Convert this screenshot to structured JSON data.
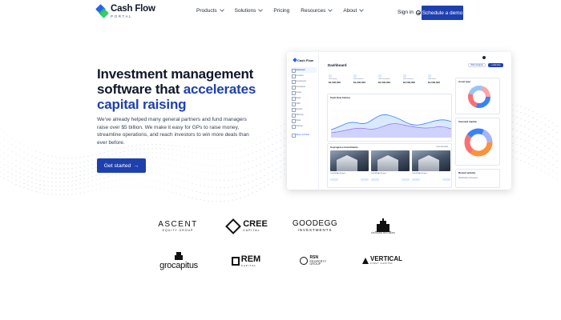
{
  "header": {
    "logo_name": "Cash Flow",
    "logo_sub": "PORTAL",
    "nav": [
      {
        "label": "Products",
        "has_menu": true
      },
      {
        "label": "Solutions",
        "has_menu": true
      },
      {
        "label": "Pricing",
        "has_menu": false
      },
      {
        "label": "Resources",
        "has_menu": true
      },
      {
        "label": "About",
        "has_menu": true
      }
    ],
    "signin_label": "Sign in",
    "demo_label": "Schedule a demo"
  },
  "hero": {
    "title_plain": "Investment management software that ",
    "title_accent": "accelerates capital raising",
    "description": "We've already helped many general partners and fund managers raise over $5 billion. We make it easy for GPs to raise money, streamline operations, and reach investors to win more deals than ever before.",
    "cta_label": "Get started",
    "cta_icon": "arrow-right-icon"
  },
  "dashboard": {
    "logo": "Cash Flow",
    "title": "Dashboard",
    "nav_items": [
      "Dashboard",
      "Investors",
      "Investments",
      "Companies",
      "Assets",
      "Deals",
      "CRM",
      "Reports",
      "Offerings",
      "Tasks",
      "Settings"
    ],
    "nav_link": "Return to Portal",
    "pills": [
      "Offer Analysis",
      "+ Add New"
    ],
    "stats": [
      {
        "label": "Total Equity",
        "value": "$1,500,000"
      },
      {
        "label": "Total Invested",
        "value": "$1,200,000"
      },
      {
        "label": "Total Distributed",
        "value": "$1,500,000"
      },
      {
        "label": "Total Investors",
        "value": "$1,500,000"
      },
      {
        "label": "Total Deals",
        "value": "$1,500,000"
      }
    ],
    "chart_title": "Cash flow history",
    "pie1_title": "Asset type",
    "pie2_title": "Invested capital",
    "investments_title": "In-progress investments",
    "investments_link": "View all deals",
    "properties": [
      "Oak Hill Apt Project",
      "Oak Hill Apt Project",
      "Oak Hill Apt Project"
    ],
    "activity_title": "Recent activity",
    "activity_item": "Distribution processed"
  },
  "logos": [
    {
      "name": "ASCENT",
      "sub": "EQUITY GROUP"
    },
    {
      "name": "CREE",
      "sub": "CAPITAL"
    },
    {
      "name": "GOODEGG",
      "sub": "INVESTMENTS"
    },
    {
      "name": "",
      "sub": "CRUSADE BUILDERS"
    },
    {
      "name": "grocapitus",
      "sub": ""
    },
    {
      "name": "REM",
      "sub": "CAPITAL"
    },
    {
      "name": "RSN",
      "sub": "PROPERTY GROUP"
    },
    {
      "name": "VERTICAL",
      "sub": "FIRST CAPITAL"
    }
  ],
  "colors": {
    "brand": "#1e40af",
    "accent_green": "#22c55e",
    "text": "#0f172a"
  }
}
